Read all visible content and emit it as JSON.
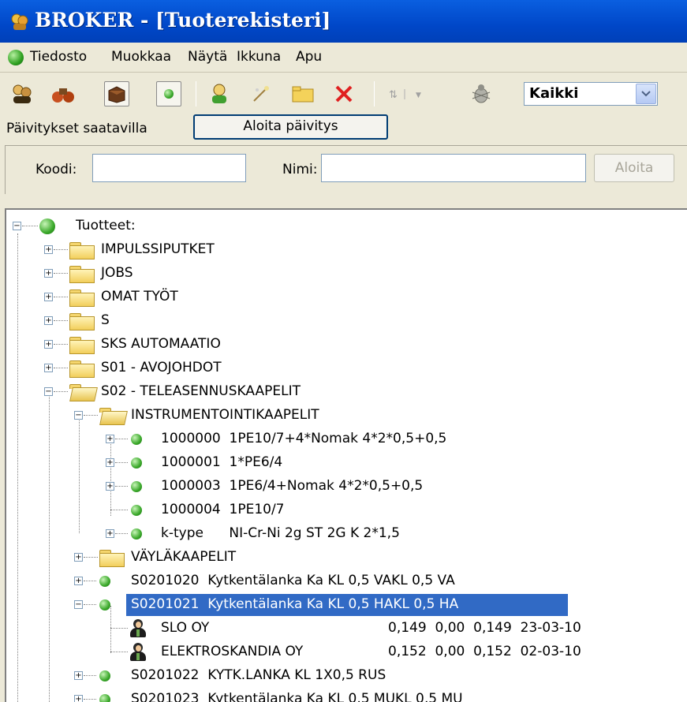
{
  "window": {
    "title": "BROKER - [Tuoterekisteri]"
  },
  "menu": {
    "items": [
      "Tiedosto",
      "Muokkaa",
      "Näytä",
      "Ikkuna",
      "Apu"
    ]
  },
  "toolbar": {
    "icons": [
      "people-icon",
      "binoculars-icon",
      "brown-box-icon",
      "green-dot-icon",
      "user-icon",
      "wand-icon",
      "folder-new-icon",
      "delete-icon",
      "sort-icon",
      "bug-icon"
    ],
    "filter_value": "Kaikki"
  },
  "updates": {
    "label": "Päivitykset saatavilla",
    "button": "Aloita päivitys"
  },
  "search": {
    "code_label": "Koodi:",
    "name_label": "Nimi:",
    "code_value": "",
    "name_value": "",
    "start_button": "Aloita"
  },
  "tree": {
    "root": "Tuotteet:",
    "rows": [
      {
        "text": "IMPULSSIPUTKET"
      },
      {
        "text": "JOBS"
      },
      {
        "text": "OMAT TYÖT"
      },
      {
        "text": "S"
      },
      {
        "text": "SKS AUTOMAATIO"
      },
      {
        "text": "S01 - AVOJOHDOT"
      },
      {
        "text": "S02 - TELEASENNUSKAAPELIT"
      },
      {
        "text": "INSTRUMENTOINTIKAAPELIT"
      },
      {
        "text": "1000000  1PE10/7+4*Nomak 4*2*0,5+0,5"
      },
      {
        "text": "1000001  1*PE6/4"
      },
      {
        "text": "1000003  1PE6/4+Nomak 4*2*0,5+0,5"
      },
      {
        "text": "1000004  1PE10/7"
      },
      {
        "text": "k-type      NI-Cr-Ni 2g ST 2G K 2*1,5"
      },
      {
        "text": "VÄYLÄKAAPELIT"
      },
      {
        "text": "S0201020  Kytkentälanka Ka KL 0,5 VAKL 0,5 VA"
      },
      {
        "text": "S0201021  Kytkentälanka Ka KL 0,5 HAKL 0,5 HA"
      },
      {
        "text": "SLO OY",
        "values": "0,149  0,00  0,149  23-03-10"
      },
      {
        "text": "ELEKTROSKANDIA OY",
        "values": "0,152  0,00  0,152  02-03-10"
      },
      {
        "text": "S0201022  KYTK.LANKA KL 1X0,5 RUS"
      },
      {
        "text": "S0201023  Kytkentälanka Ka KL 0,5 MUKL 0,5 MU"
      }
    ]
  }
}
